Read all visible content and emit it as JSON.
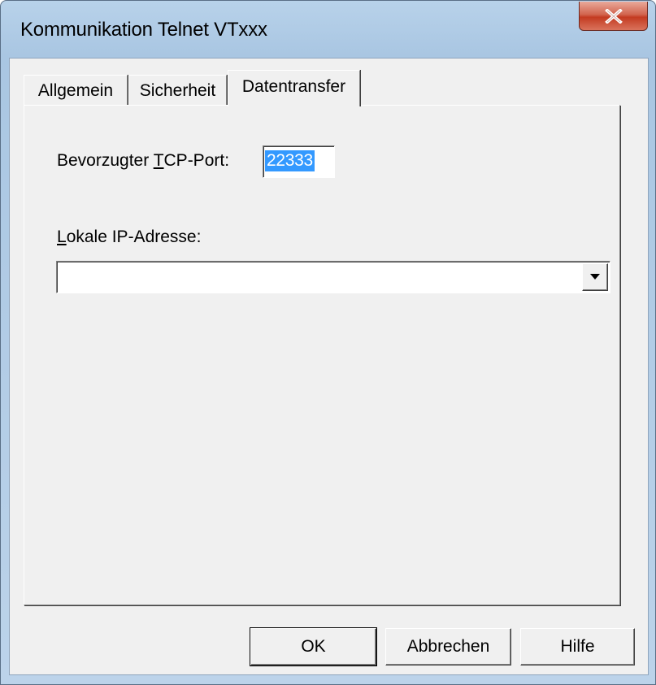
{
  "window": {
    "title": "Kommunikation Telnet VTxxx",
    "close_glyph": "X"
  },
  "tabs": [
    {
      "label": "Allgemein",
      "active": false
    },
    {
      "label": "Sicherheit",
      "active": false
    },
    {
      "label": "Datentransfer",
      "active": true
    }
  ],
  "form": {
    "tcp_port": {
      "label_pre": "Bevorzugter ",
      "label_mnemonic": "T",
      "label_post": "CP-Port:",
      "value": "22333",
      "selected": true
    },
    "local_ip": {
      "label_mnemonic": "L",
      "label_post": "okale IP-Adresse:",
      "value": ""
    }
  },
  "buttons": {
    "ok": "OK",
    "cancel": "Abbrechen",
    "help": "Hilfe"
  },
  "colors": {
    "selection": "#3399ff",
    "dialog_bg": "#f0f0f0",
    "close_button": "#c43b21"
  }
}
